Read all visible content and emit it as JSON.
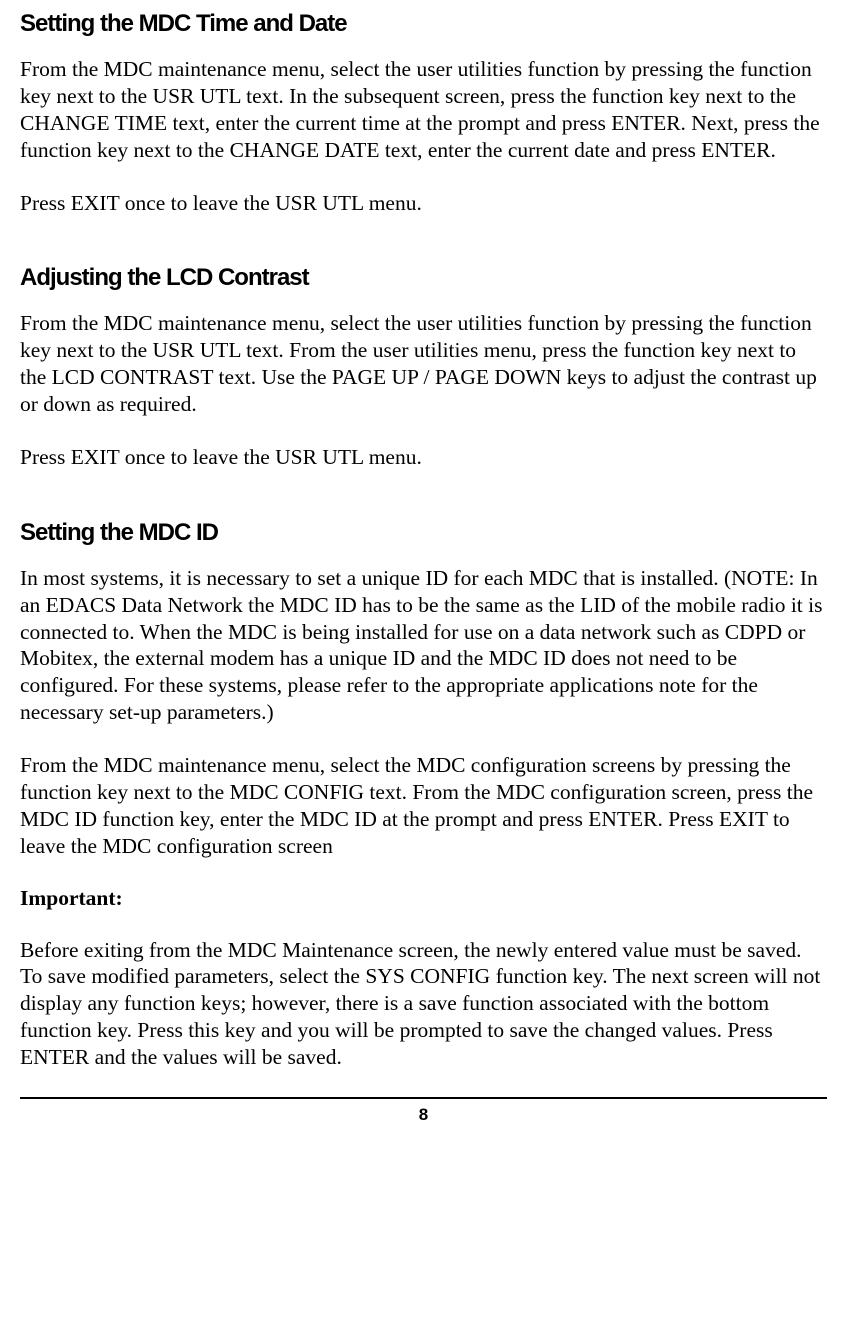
{
  "sections": [
    {
      "heading": "Setting  the MDC Time and Date",
      "paragraphs": [
        "From the MDC maintenance menu, select the user utilities function by pressing the function key next to the USR UTL text.  In the subsequent screen, press the function key next to the CHANGE TIME text, enter the current time at the prompt and press ENTER.  Next, press the function key next to the CHANGE DATE text, enter the current date and press ENTER.",
        "Press EXIT once to leave the USR UTL menu."
      ]
    },
    {
      "heading": "Adjusting the LCD Contrast",
      "paragraphs": [
        "From the MDC maintenance menu, select the user utilities function by pressing the function key next to the USR UTL text.  From the user utilities menu, press the function key next to the LCD CONTRAST text.  Use the PAGE UP / PAGE DOWN keys to adjust the contrast up or down as required.",
        "Press EXIT once to leave the USR UTL menu."
      ]
    },
    {
      "heading": "Setting the MDC ID",
      "paragraphs": [
        "In most systems, it is necessary to set a unique ID for each MDC that is installed. (NOTE: In an EDACS Data Network the MDC ID has to be the same as the LID of the mobile radio it is connected to.  When the MDC is being installed for use on a data network such as CDPD or Mobitex, the external modem has a unique ID and the MDC ID does not need to be configured.  For these systems, please refer to the appropriate applications note for the necessary set-up parameters.)",
        "From the MDC maintenance menu, select the MDC configuration screens by pressing the function key next to the MDC CONFIG text.  From the MDC configuration screen, press the MDC ID function key, enter the MDC ID at the prompt and press ENTER.  Press EXIT to leave the MDC configuration screen"
      ],
      "important_label": "Important:",
      "important_body": "Before exiting from the MDC Maintenance screen, the newly entered value must be saved.  To save modified parameters, select the SYS CONFIG function key.  The next screen will not display any function keys; however, there is a save function associated with the bottom function key.  Press this key and you will be prompted to save the changed values.  Press ENTER and the values will be saved."
    }
  ],
  "page_number": "8"
}
